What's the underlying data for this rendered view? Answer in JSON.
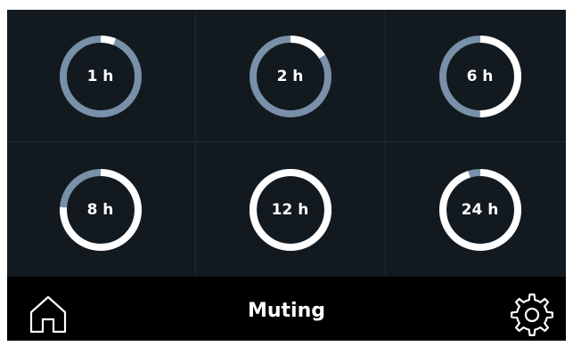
{
  "colors": {
    "background": "#121a20",
    "bar": "#000000",
    "ring_track": "#7890a8",
    "ring_fill": "#ffffff",
    "text": "#ffffff"
  },
  "options": [
    {
      "label": "1 h",
      "progress": 0.06
    },
    {
      "label": "2 h",
      "progress": 0.16
    },
    {
      "label": "6 h",
      "progress": 0.5
    },
    {
      "label": "8 h",
      "progress": 0.76
    },
    {
      "label": "12 h",
      "progress": 1.0
    },
    {
      "label": "24 h",
      "progress": 0.95
    }
  ],
  "bottom_bar": {
    "title": "Muting",
    "home_icon": "home-icon",
    "settings_icon": "gear-icon"
  }
}
